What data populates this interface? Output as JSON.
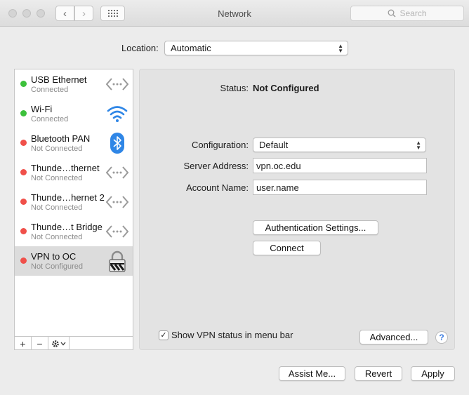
{
  "window": {
    "title": "Network",
    "search_placeholder": "Search"
  },
  "location": {
    "label": "Location:",
    "value": "Automatic"
  },
  "services": [
    {
      "name": "USB Ethernet",
      "status": "Connected",
      "state": "green",
      "icon": "ethernet-arrows-icon"
    },
    {
      "name": "Wi-Fi",
      "status": "Connected",
      "state": "green",
      "icon": "wifi-icon"
    },
    {
      "name": "Bluetooth PAN",
      "status": "Not Connected",
      "state": "red",
      "icon": "bluetooth-icon"
    },
    {
      "name": "Thunde…thernet",
      "status": "Not Connected",
      "state": "red",
      "icon": "ethernet-arrows-icon"
    },
    {
      "name": "Thunde…hernet 2",
      "status": "Not Connected",
      "state": "red",
      "icon": "ethernet-arrows-icon"
    },
    {
      "name": "Thunde…t Bridge",
      "status": "Not Connected",
      "state": "red",
      "icon": "ethernet-arrows-icon"
    },
    {
      "name": "VPN to OC",
      "status": "Not Configured",
      "state": "red",
      "icon": "lock-icon",
      "selected": true
    }
  ],
  "sidebar_toolbar": {
    "add": "+",
    "remove": "−"
  },
  "detail": {
    "status_label": "Status:",
    "status_value": "Not Configured",
    "configuration_label": "Configuration:",
    "configuration_value": "Default",
    "server_label": "Server Address:",
    "server_value": "vpn.oc.edu",
    "account_label": "Account Name:",
    "account_value": "user.name",
    "auth_button": "Authentication Settings...",
    "connect_button": "Connect",
    "show_vpn_label": "Show VPN status in menu bar",
    "show_vpn_checked": true,
    "advanced_button": "Advanced...",
    "help": "?"
  },
  "footer": {
    "assist": "Assist Me...",
    "revert": "Revert",
    "apply": "Apply"
  },
  "colors": {
    "connected": "#3cc13b",
    "not_connected": "#f0504a",
    "bluetooth": "#2f86e6",
    "wifi": "#2f86e6"
  }
}
